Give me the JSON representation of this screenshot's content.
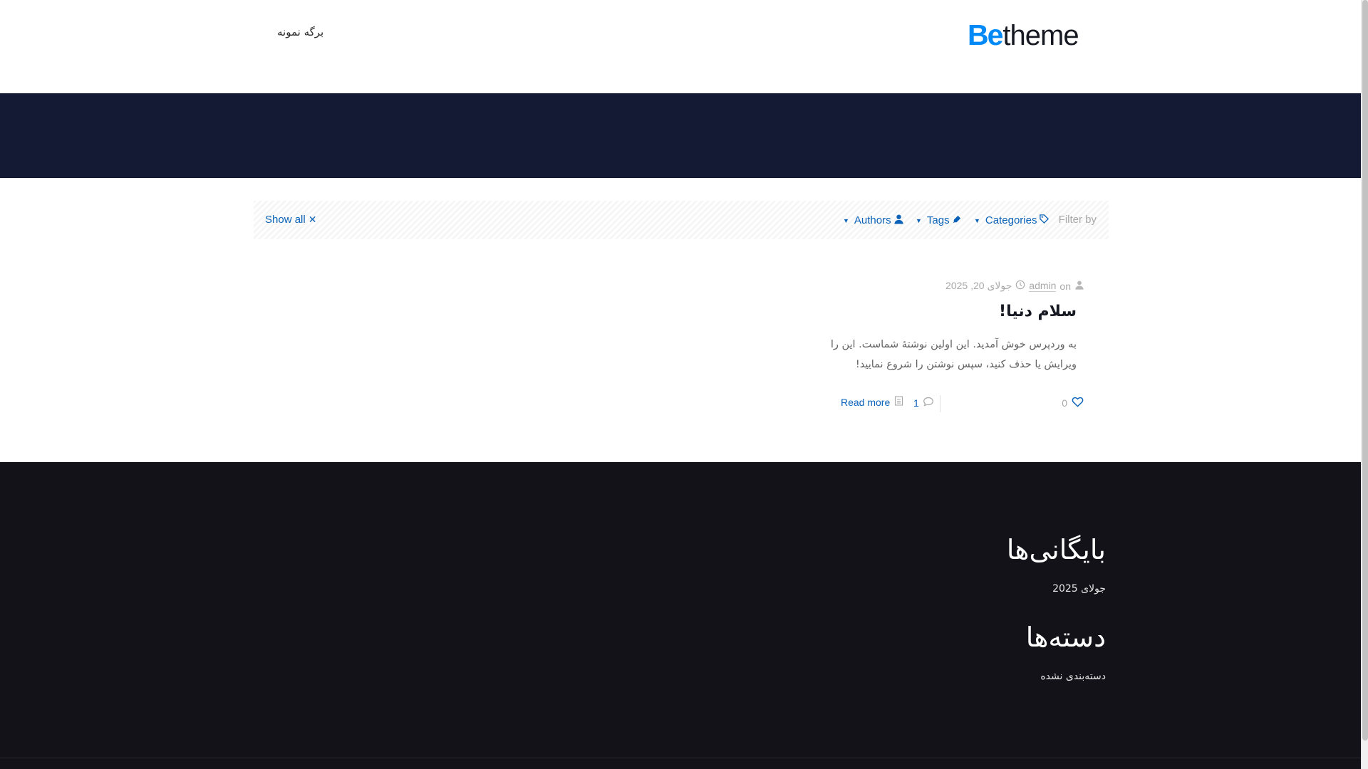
{
  "header": {
    "logo_be": "Be",
    "logo_theme": "theme",
    "nav_item": "برگه نمونه"
  },
  "filters": {
    "filter_by": "Filter by",
    "categories": "Categories",
    "tags": "Tags",
    "authors": "Authors",
    "show_all": "Show all"
  },
  "post": {
    "by": "on",
    "author": "admin",
    "date": "جولای 20, 2025",
    "title": "سلام دنیا!",
    "excerpt": "به وردپرس خوش آمدید. این اولین نوشتهٔ شماست. این را ویرایش یا حذف کنید، سپس نوشتن را شروع نمایید!",
    "likes": "0",
    "comments": "1",
    "read_more": "Read more"
  },
  "footer": {
    "archives_title": "بایگانی‌ها",
    "archives_item": "جولای 2025",
    "categories_title": "دسته‌ها",
    "categories_item": "دسته‌بندی نشده"
  },
  "colors": {
    "accent": "#0a62b8",
    "logo_blue": "#0089f7",
    "subheader_bg": "#141a33",
    "footer_bg": "#121218"
  },
  "icons": [
    "user-icon",
    "clock-icon",
    "heart-icon",
    "comment-icon",
    "document-icon",
    "tag-icon",
    "close-icon",
    "caret-down-icon"
  ]
}
